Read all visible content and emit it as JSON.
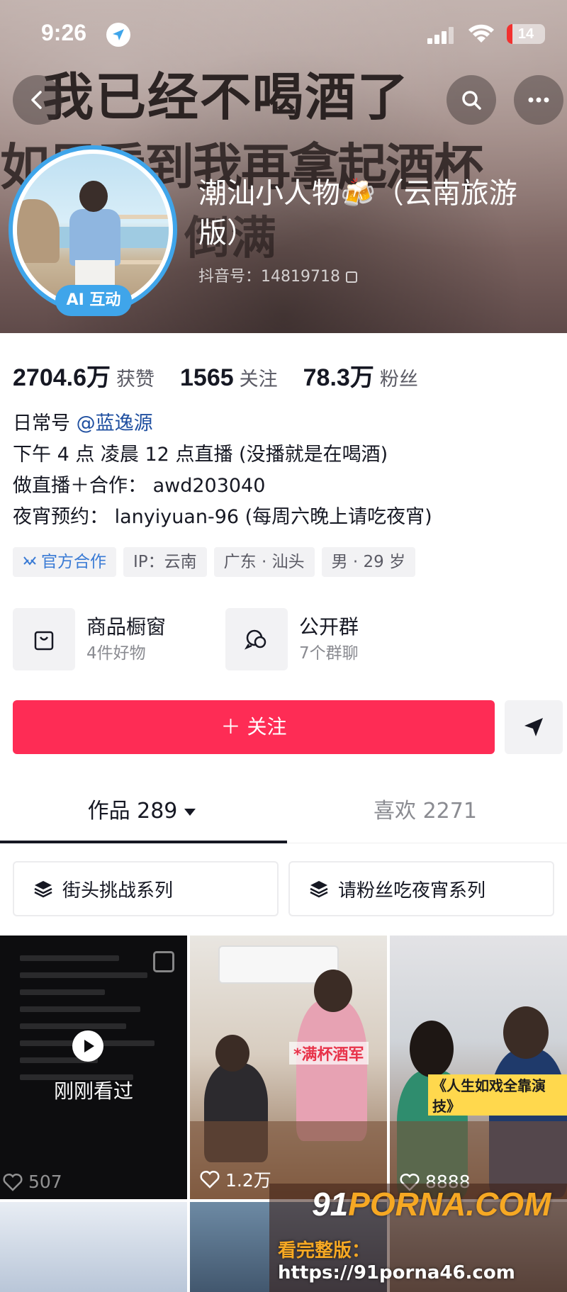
{
  "status_bar": {
    "time": "9:26",
    "battery": "14",
    "battery_level": 0.14
  },
  "banner": {
    "calligraphy": [
      "我已经不喝酒了",
      "如果看到我再拿起酒杯",
      "倒满"
    ]
  },
  "profile": {
    "avatar_badge": "AI 互动",
    "nickname": "潮汕小人物🍻（云南旅游版）",
    "douyin_id_label": "抖音号：",
    "douyin_id": "14819718",
    "stats": [
      {
        "value": "2704.6万",
        "label": "获赞"
      },
      {
        "value": "1565",
        "label": "关注"
      },
      {
        "value": "78.3万",
        "label": "粉丝"
      }
    ],
    "bio": {
      "line1_prefix": "日常号",
      "line1_mention": "@蓝逸源",
      "line2": "下午 4 点 凌晨 12 点直播 (没播就是在喝酒)",
      "line3": "做直播＋合作： awd203040",
      "line4": "夜宵预约： lanyiyuan-96 (每周六晚上请吃夜宵)"
    },
    "tags": [
      "官方合作",
      "IP：云南",
      "广东 · 汕头",
      "男 · 29 岁"
    ]
  },
  "features": [
    {
      "title": "商品橱窗",
      "sub": "4件好物",
      "icon": "shopping-bag-icon"
    },
    {
      "title": "公开群",
      "sub": "7个群聊",
      "icon": "chat-group-icon"
    }
  ],
  "actions": {
    "follow": "＋ 关注",
    "share_icon": "send-arrow-icon"
  },
  "tabs": {
    "works": "作品 289",
    "likes": "喜欢 2271"
  },
  "series": [
    {
      "label": "街头挑战系列"
    },
    {
      "label": "请粉丝吃夜宵系列"
    }
  ],
  "videos": [
    {
      "likes": "507",
      "overlay": "刚刚看过"
    },
    {
      "likes": "1.2万",
      "caption": "*满杯酒军"
    },
    {
      "likes": "8888",
      "caption": "《人生如戏全靠演技》"
    }
  ],
  "watermark": {
    "logo_91": "91",
    "logo_text": "PORNA.COM",
    "url_prefix": "看完整版：",
    "url": "https://91porna46.com"
  }
}
